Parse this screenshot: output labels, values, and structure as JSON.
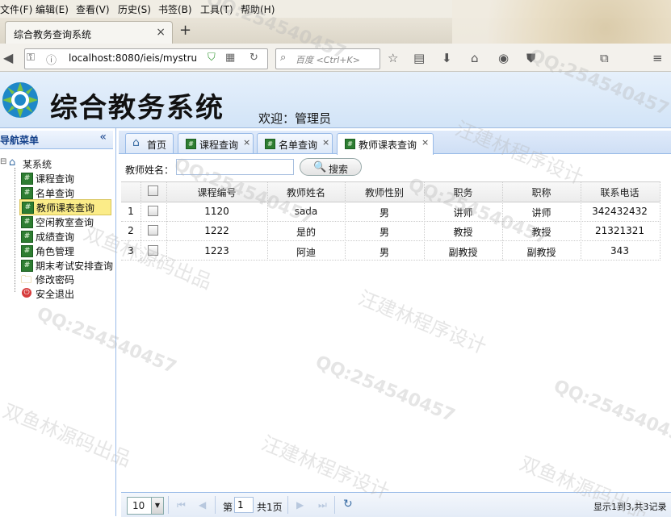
{
  "browser": {
    "menu": [
      "文件(F)",
      "编辑(E)",
      "查看(V)",
      "历史(S)",
      "书签(B)",
      "工具(T)",
      "帮助(H)"
    ],
    "tab_title": "综合教务查询系统",
    "tab_close": "×",
    "new_tab": "+",
    "url": "localhost:8080/ieis/mystru",
    "search_placeholder": "百度 <Ctrl+K>"
  },
  "app": {
    "title": "综合教务系统",
    "welcome": "欢迎：管理员"
  },
  "sidebar": {
    "header": "导航菜单",
    "collapse": "«",
    "root": "某系统",
    "items": [
      {
        "label": "课程查询"
      },
      {
        "label": "名单查询"
      },
      {
        "label": "教师课表查询",
        "selected": true
      },
      {
        "label": "空闲教室查询"
      },
      {
        "label": "成绩查询"
      },
      {
        "label": "角色管理"
      },
      {
        "label": "期末考试安排查询"
      },
      {
        "label": "修改密码"
      },
      {
        "label": "安全退出"
      }
    ]
  },
  "tabs": [
    {
      "label": "首页",
      "closable": false
    },
    {
      "label": "课程查询",
      "closable": true
    },
    {
      "label": "名单查询",
      "closable": true
    },
    {
      "label": "教师课表查询",
      "closable": true,
      "active": true
    }
  ],
  "search": {
    "label": "教师姓名：",
    "value": "",
    "button": "搜索"
  },
  "grid": {
    "columns": [
      "课程编号",
      "教师姓名",
      "教师性别",
      "职务",
      "职称",
      "联系电话"
    ],
    "rows": [
      {
        "num": "1",
        "cells": [
          "1120",
          "sada",
          "男",
          "讲师",
          "讲师",
          "342432432"
        ]
      },
      {
        "num": "2",
        "cells": [
          "1222",
          "是的",
          "男",
          "教授",
          "教授",
          "21321321"
        ]
      },
      {
        "num": "3",
        "cells": [
          "1223",
          "阿迪",
          "男",
          "副教授",
          "副教授",
          "343"
        ]
      }
    ]
  },
  "pager": {
    "page_size": "10",
    "page_prefix": "第",
    "page": "1",
    "page_suffix": "共1页",
    "summary": "显示1到3,共3记录"
  },
  "watermarks": [
    "QQ:254540457",
    "汪建林程序设计",
    "双鱼林源码出品"
  ]
}
